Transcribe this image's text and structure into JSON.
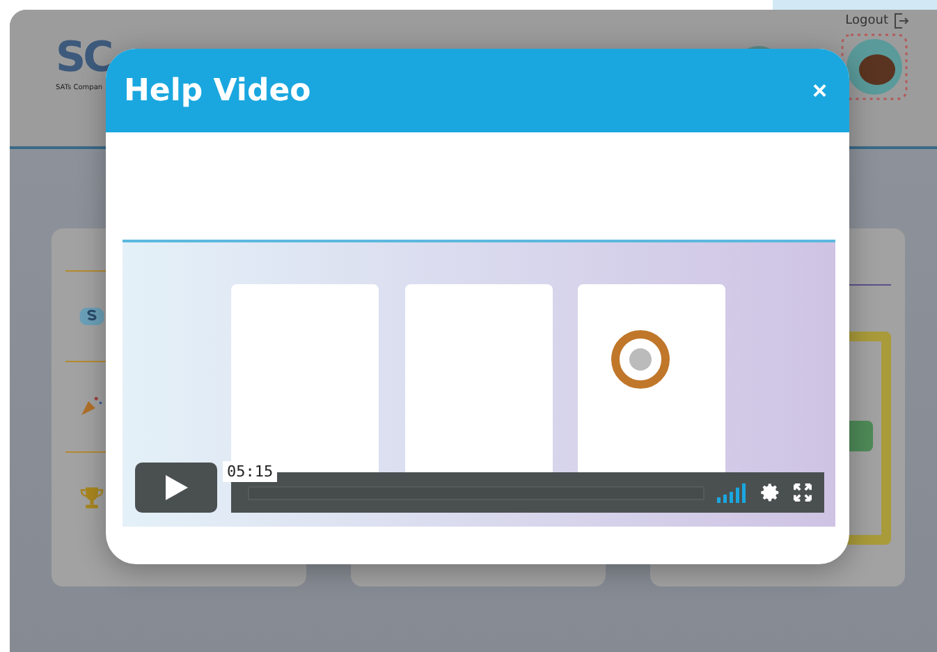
{
  "background_page": {
    "logo": "SC",
    "logo_subtitle": "SATs Compan",
    "logout": "Logout"
  },
  "modal": {
    "title": "Help Video",
    "close": "×",
    "video": {
      "kind": "picture",
      "time": "05:15",
      "playing": false,
      "progress": {
        "level": 0
      }
    }
  }
}
